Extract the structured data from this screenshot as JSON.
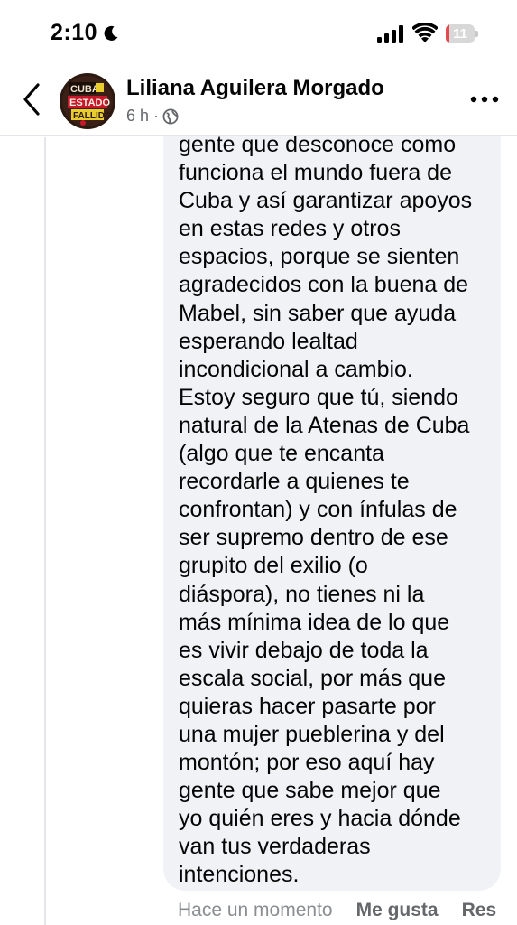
{
  "status_bar": {
    "time": "2:10",
    "battery_level": "11",
    "battery_fraction": 0.11,
    "battery_color": "#e5484d",
    "icons": [
      "moon-icon",
      "signal-icon",
      "wifi-icon",
      "battery-icon"
    ]
  },
  "header": {
    "author_name": "Liliana Aguilera Morgado",
    "time_ago": "6 h",
    "separator": "·",
    "icons": [
      "back-icon",
      "globe-icon",
      "more-icon"
    ]
  },
  "comment": {
    "lines": [
      "gente que desconoce como",
      "funciona el mundo fuera de",
      "Cuba y así garantizar apoyos",
      "en estas redes y otros",
      "espacios, porque se sienten",
      "agradecidos con la buena de",
      "Mabel, sin saber que ayuda",
      "esperando lealtad",
      "incondicional a cambio.",
      "Estoy seguro que tú, siendo",
      "natural de la Atenas de Cuba",
      "(algo que te encanta",
      "recordarle a quienes te",
      "confrontan) y con ínfulas de",
      "ser supremo dentro de ese",
      "grupito del exilio (o",
      "diáspora), no tienes ni la",
      "más mínima idea de lo que",
      "es vivir debajo de toda la",
      "escala social, por más que",
      "quieras hacer pasarte por",
      "una mujer pueblerina y del",
      "montón; por eso aquí hay",
      "gente que sabe mejor que",
      "yo quién eres y hacia dónde",
      "van tus verdaderas",
      "intenciones."
    ]
  },
  "actions": {
    "timestamp": "Hace un momento",
    "like_label": "Me gusta",
    "reply_label": "Res"
  },
  "colors": {
    "bubble_bg": "#f0f2f5",
    "secondary_text": "#65676b",
    "primary_text": "#050505"
  }
}
